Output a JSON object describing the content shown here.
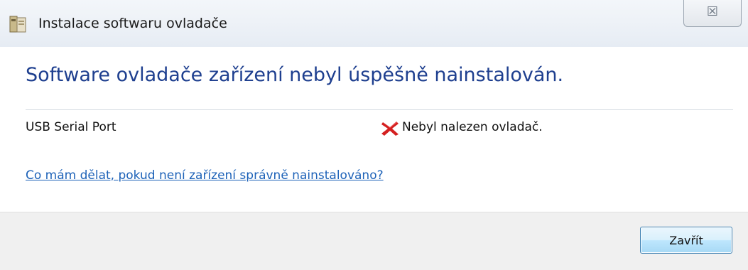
{
  "window": {
    "title": "Instalace softwaru ovladače",
    "close_glyph": "☒"
  },
  "main": {
    "heading": "Software ovladače zařízení nebyl úspěšně nainstalován.",
    "device": {
      "name": "USB Serial Port",
      "status": "Nebyl nalezen ovladač.",
      "status_icon": "error-x-icon",
      "status_color": "#d42020"
    },
    "help_link": "Co mám dělat, pokud není zařízení správně nainstalováno?"
  },
  "footer": {
    "close_label": "Zavřít"
  },
  "colors": {
    "heading": "#1e3f8f",
    "link": "#1d62b8",
    "footer_bg": "#f0f0f0",
    "button_border": "#3c7fb1"
  }
}
